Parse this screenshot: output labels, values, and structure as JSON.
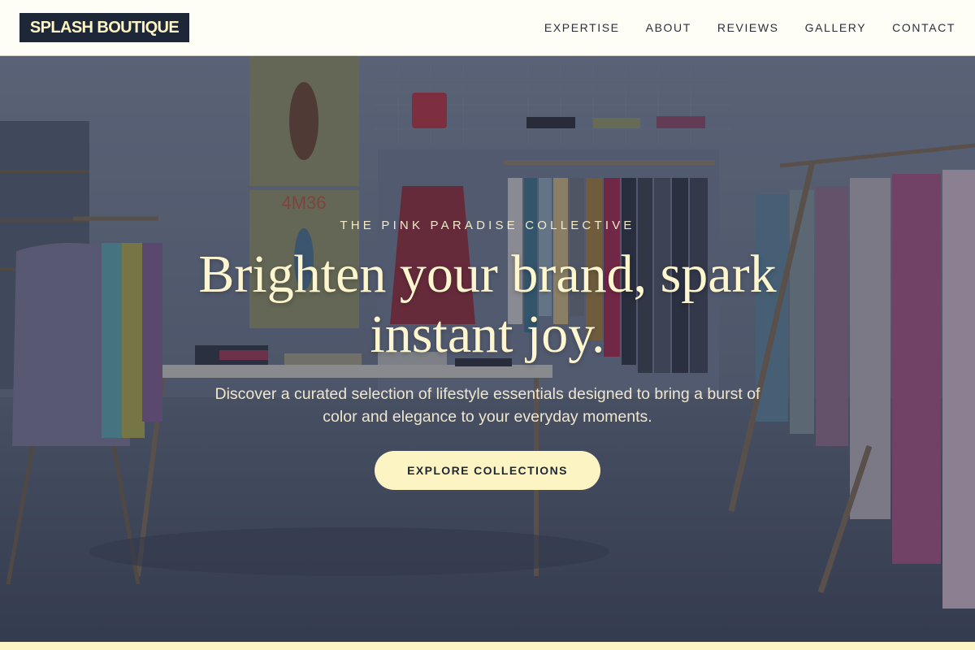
{
  "header": {
    "logo": "SPLASH BOUTIQUE",
    "nav": [
      "EXPERTISE",
      "ABOUT",
      "REVIEWS",
      "GALLERY",
      "CONTACT"
    ]
  },
  "hero": {
    "eyebrow": "THE PINK PARADISE COLLECTIVE",
    "headline": "Brighten your brand, spark instant joy.",
    "subtext": "Discover a curated selection of lifestyle essentials designed to bring a burst of color and elegance to your everyday moments.",
    "cta_label": "EXPLORE COLLECTIONS",
    "poster_text": "4M36"
  },
  "colors": {
    "logo_bg": "#1e2738",
    "accent_cream": "#fdf4c4",
    "header_bg": "#fffef6"
  }
}
